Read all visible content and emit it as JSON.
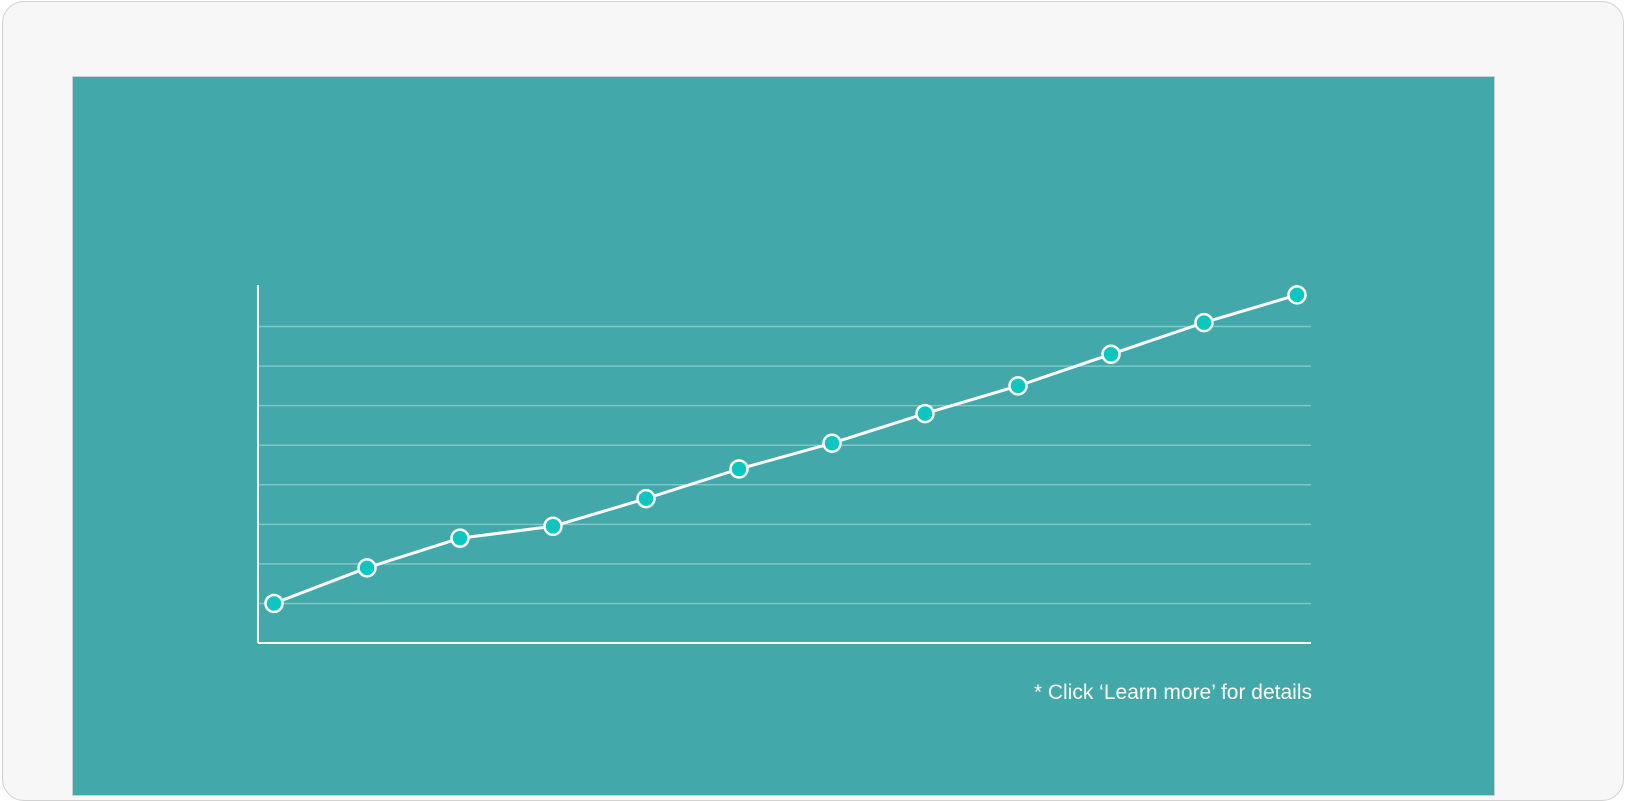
{
  "colors": {
    "frame_bg": "#f7f7f7",
    "screen_bg": "#42a8a9",
    "line": "#ffffff",
    "grid": "#7ec8c8",
    "marker_fill": "#0ec6c0",
    "marker_stroke": "#ffffff"
  },
  "footnote": "* Click ‘Learn more’ for details",
  "chart_data": {
    "type": "line",
    "title": "",
    "xlabel": "",
    "ylabel": "",
    "grid": true,
    "axis_labels_shown": false,
    "x": [
      1,
      2,
      3,
      4,
      5,
      6,
      7,
      8,
      9,
      10,
      11,
      12
    ],
    "ylim": [
      0,
      9
    ],
    "gridlines": [
      1,
      2,
      3,
      4,
      5,
      6,
      7,
      8
    ],
    "series": [
      {
        "values": [
          1.0,
          1.9,
          2.65,
          2.95,
          3.65,
          4.4,
          5.05,
          5.8,
          6.5,
          7.3,
          8.1,
          8.8
        ]
      }
    ]
  }
}
